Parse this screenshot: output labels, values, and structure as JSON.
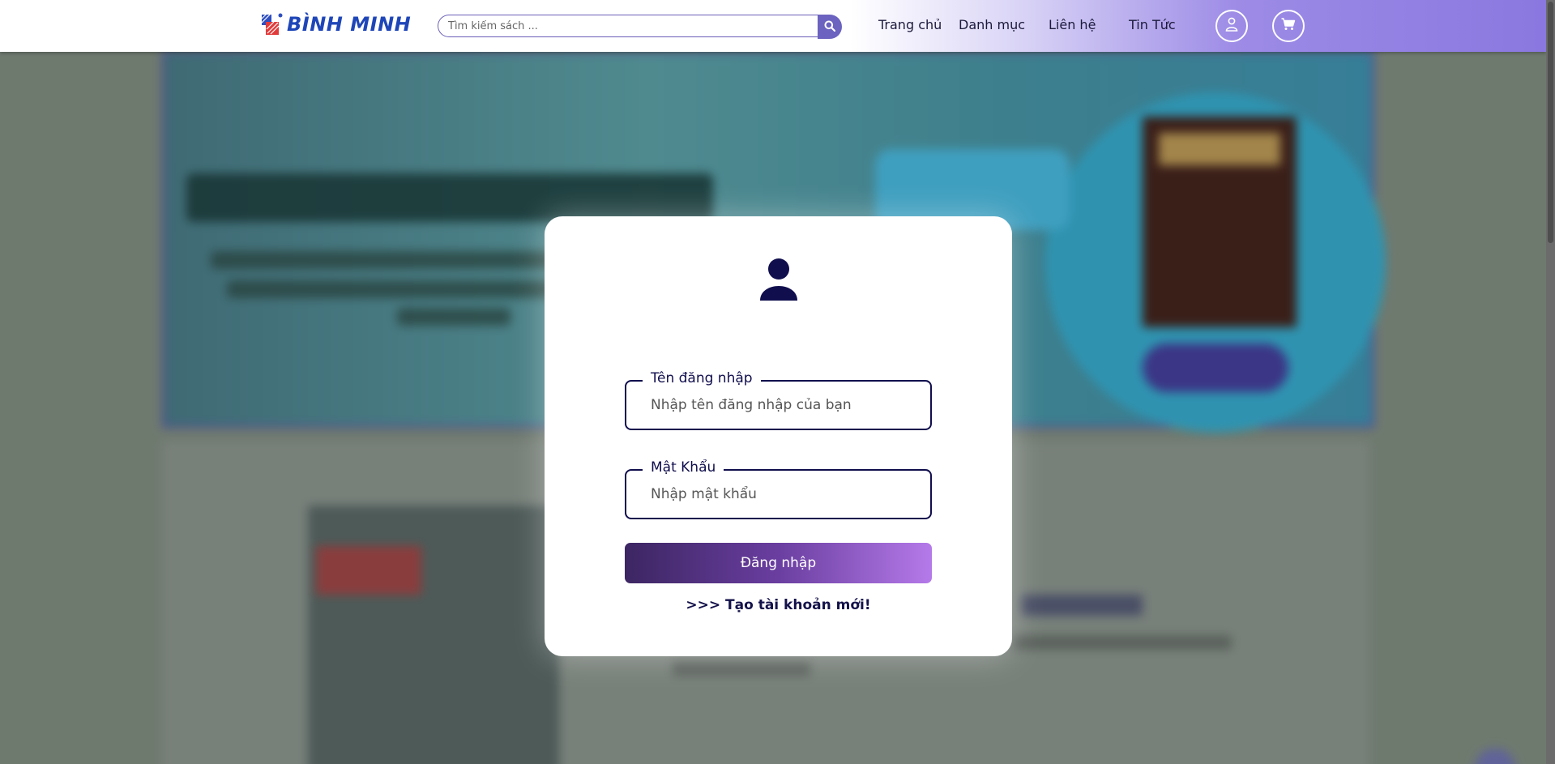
{
  "header": {
    "logo_text": "BÌNH MINH",
    "search": {
      "placeholder": "Tìm kiếm sách ..."
    },
    "nav": [
      {
        "label": "Trang chủ"
      },
      {
        "label": "Danh mục"
      },
      {
        "label": "Liên hệ"
      },
      {
        "label": "Tin Tức"
      }
    ],
    "icons": {
      "search": "search-icon",
      "account": "user-icon",
      "cart": "cart-icon"
    }
  },
  "login_modal": {
    "icon": "user-icon",
    "username": {
      "label": "Tên đăng nhập",
      "placeholder": "Nhập tên đăng nhập của bạn",
      "value": ""
    },
    "password": {
      "label": "Mật Khẩu",
      "placeholder": "Nhập mật khẩu",
      "value": ""
    },
    "submit_label": "Đăng nhập",
    "register_link": ">>> Tạo tài khoản mới!"
  },
  "colors": {
    "primary": "#100e4d",
    "button_gradient_start": "#3c2662",
    "button_gradient_end": "#b57ae9",
    "logo_blue": "#1f46b8",
    "header_accent": "#8a78e0"
  }
}
